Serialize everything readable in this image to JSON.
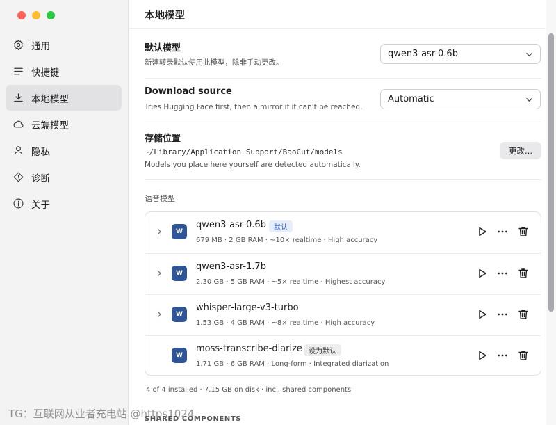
{
  "sidebar": {
    "items": [
      {
        "label": "通用",
        "icon": "gear-icon"
      },
      {
        "label": "快捷键",
        "icon": "lines-icon"
      },
      {
        "label": "本地模型",
        "icon": "download-icon",
        "active": true
      },
      {
        "label": "云端模型",
        "icon": "cloud-icon"
      },
      {
        "label": "隐私",
        "icon": "person-icon"
      },
      {
        "label": "诊断",
        "icon": "warning-icon"
      },
      {
        "label": "关于",
        "icon": "info-icon"
      }
    ]
  },
  "main": {
    "title": "本地模型",
    "default_model": {
      "title": "默认模型",
      "desc": "新建转录默认使用此模型，除非手动更改。",
      "value": "qwen3-asr-0.6b"
    },
    "download_source": {
      "title": "Download source",
      "desc": "Tries Hugging Face first, then a mirror if it can't be reached.",
      "value": "Automatic"
    },
    "storage": {
      "title": "存储位置",
      "path": "~/Library/Application Support/BaoCut/models",
      "desc": "Models you place here yourself are detected automatically.",
      "button": "更改..."
    },
    "section_label": "语音模型",
    "models": [
      {
        "name": "qwen3-asr-0.6b",
        "badge": "默认",
        "badge_type": "default",
        "meta": "679 MB · 2 GB RAM · ~10× realtime · High accuracy",
        "has_chevron": true,
        "icon_label": "W"
      },
      {
        "name": "qwen3-asr-1.7b",
        "badge": "",
        "badge_type": "",
        "meta": "2.30 GB · 5 GB RAM · ~5× realtime · Highest accuracy",
        "has_chevron": true,
        "icon_label": "W"
      },
      {
        "name": "whisper-large-v3-turbo",
        "badge": "",
        "badge_type": "",
        "meta": "1.53 GB · 4 GB RAM · ~8× realtime · High accuracy",
        "has_chevron": true,
        "icon_label": "W"
      },
      {
        "name": "moss-transcribe-diarize",
        "badge": "设为默认",
        "badge_type": "set",
        "meta": "1.71 GB · 6 GB RAM · Long-form · Integrated diarization",
        "has_chevron": false,
        "icon_label": "W"
      }
    ],
    "footer_stats": "4 of 4 installed · 7.15 GB on disk · incl. shared components",
    "shared_label": "SHARED COMPONENTS"
  },
  "watermark": "TG：互联网从业者充电站 @https1024",
  "colors": {
    "accent": "#3b6dc5",
    "model_icon": "#2f5596",
    "sidebar_bg": "#f3f3f4",
    "active_item": "#e2e2e4"
  }
}
